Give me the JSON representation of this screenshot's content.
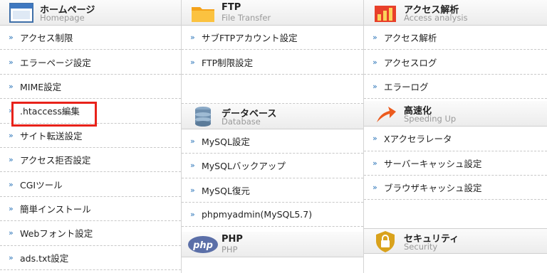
{
  "homepage": {
    "title": "ホームページ",
    "subtitle": "Homepage",
    "icon": "homepage-window-icon",
    "items": [
      {
        "label": "アクセス制限"
      },
      {
        "label": "エラーページ設定"
      },
      {
        "label": "MIME設定"
      },
      {
        "label": ".htaccess編集"
      },
      {
        "label": "サイト転送設定"
      },
      {
        "label": "アクセス拒否設定"
      },
      {
        "label": "CGIツール"
      },
      {
        "label": "簡単インストール"
      },
      {
        "label": "Webフォント設定"
      },
      {
        "label": "ads.txt設定"
      }
    ]
  },
  "ftp": {
    "title": "FTP",
    "subtitle": "File Transfer",
    "icon": "folder-icon",
    "items": [
      {
        "label": "サブFTPアカウント設定"
      },
      {
        "label": "FTP制限設定"
      }
    ]
  },
  "database": {
    "title": "データベース",
    "subtitle": "Database",
    "icon": "database-icon",
    "items": [
      {
        "label": "MySQL設定"
      },
      {
        "label": "MySQLバックアップ"
      },
      {
        "label": "MySQL復元"
      },
      {
        "label": "phpmyadmin(MySQL5.7)"
      }
    ]
  },
  "php": {
    "title": "PHP",
    "subtitle": "PHP",
    "icon": "php-logo-icon",
    "logo_text": "php"
  },
  "access": {
    "title": "アクセス解析",
    "subtitle": "Access analysis",
    "icon": "bar-chart-icon",
    "items": [
      {
        "label": "アクセス解析"
      },
      {
        "label": "アクセスログ"
      },
      {
        "label": "エラーログ"
      }
    ]
  },
  "speed": {
    "title": "高速化",
    "subtitle": "Speeding Up",
    "icon": "speed-arrow-icon",
    "items": [
      {
        "label": "Xアクセラレータ"
      },
      {
        "label": "サーバーキャッシュ設定"
      },
      {
        "label": "ブラウザキャッシュ設定"
      }
    ]
  },
  "security": {
    "title": "セキュリティ",
    "subtitle": "Security",
    "icon": "shield-lock-icon"
  },
  "arrow_glyph": "»",
  "colors": {
    "highlight": "#e8221a",
    "arrow": "#2a73b8",
    "subtitle": "#9a9a9a"
  }
}
